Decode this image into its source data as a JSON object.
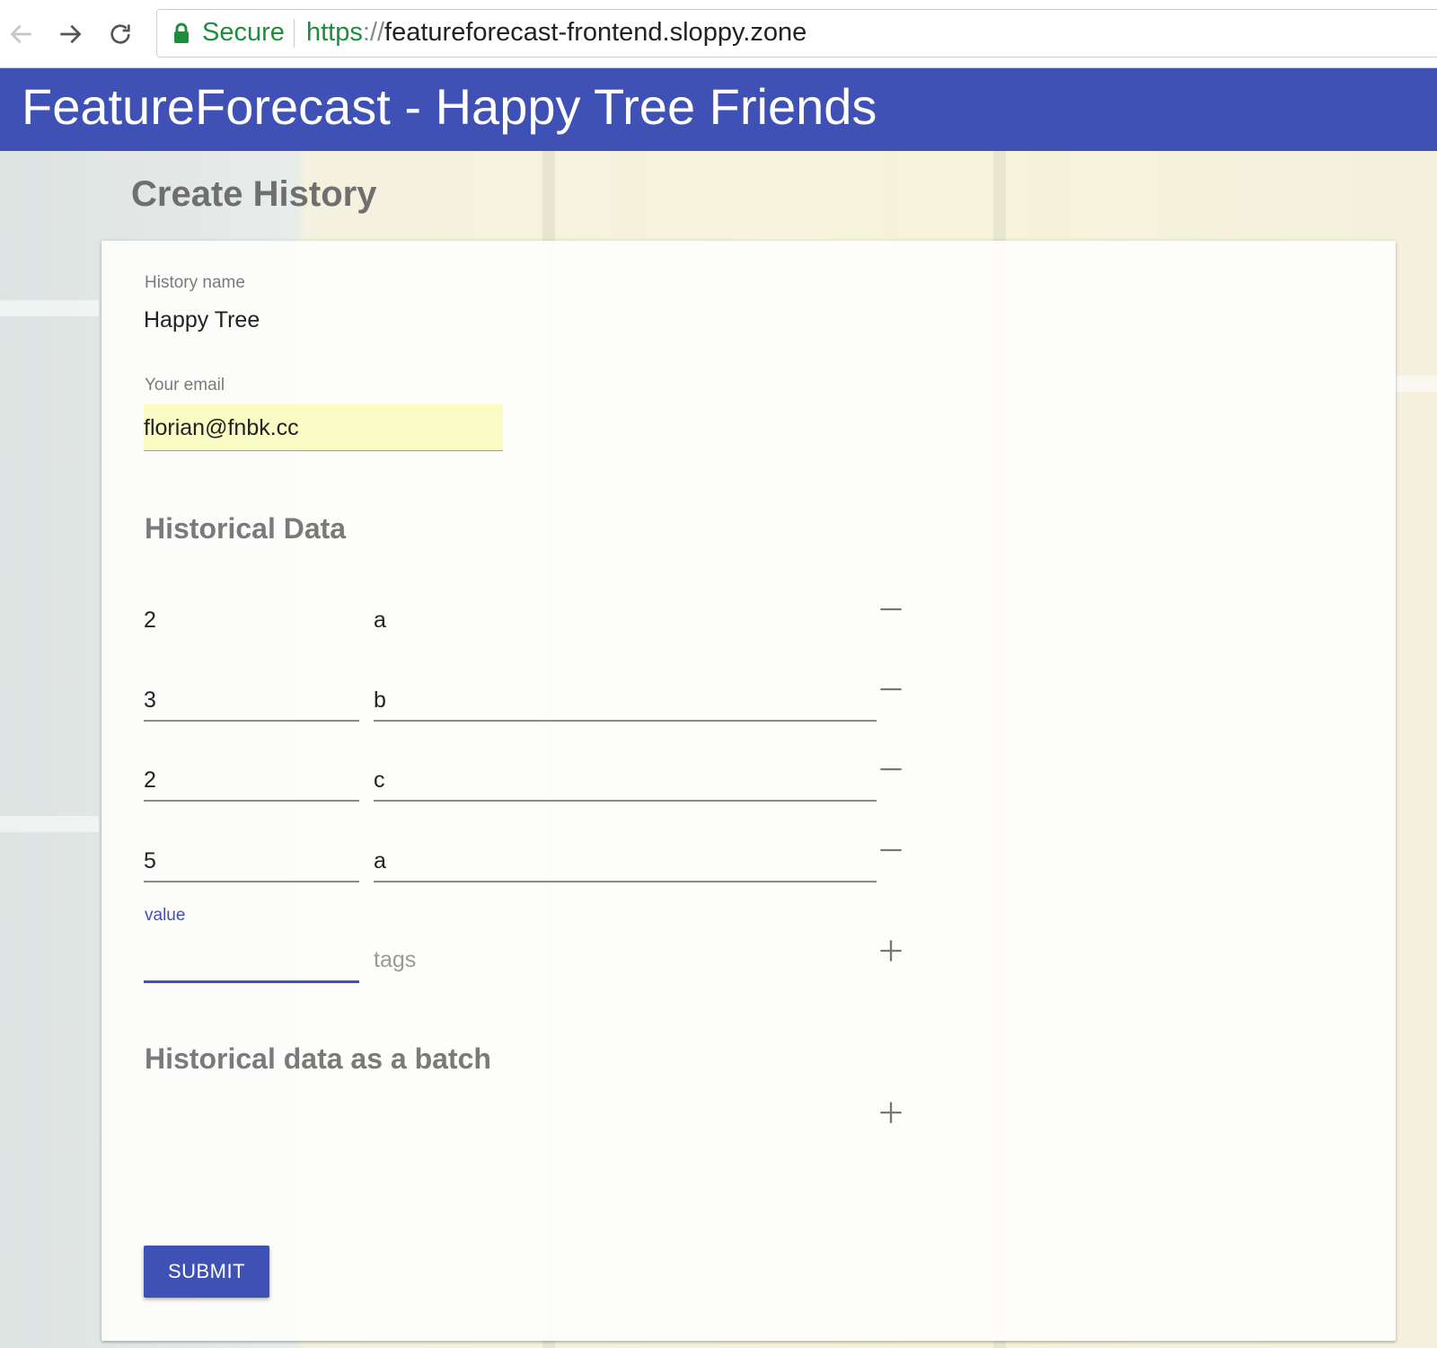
{
  "browser": {
    "secure_label": "Secure",
    "url_scheme": "https",
    "url_sep": "://",
    "url_host": "featureforecast-frontend.sloppy.zone"
  },
  "appbar": {
    "title": "FeatureForecast - Happy Tree Friends"
  },
  "page": {
    "title": "Create History"
  },
  "form": {
    "history_name_label": "History name",
    "history_name_value": "Happy Tree",
    "email_label": "Your email",
    "email_value": "florian@fnbk.cc",
    "historical_data_heading": "Historical Data",
    "rows": [
      {
        "value": "2",
        "tags": "a"
      },
      {
        "value": "3",
        "tags": "b"
      },
      {
        "value": "2",
        "tags": "c"
      },
      {
        "value": "5",
        "tags": "a"
      }
    ],
    "new_row": {
      "value_label": "value",
      "tags_placeholder": "tags"
    },
    "batch_heading": "Historical data as a batch",
    "submit_label": "SUBMIT"
  },
  "colors": {
    "primary": "#3f51b5",
    "secure_green": "#1e8e3e",
    "autofill_yellow": "#fafcc5"
  },
  "icons": {
    "back": "arrow-left-icon",
    "forward": "arrow-right-icon",
    "reload": "reload-icon",
    "lock": "lock-icon",
    "remove": "minus-icon",
    "add": "plus-icon"
  }
}
